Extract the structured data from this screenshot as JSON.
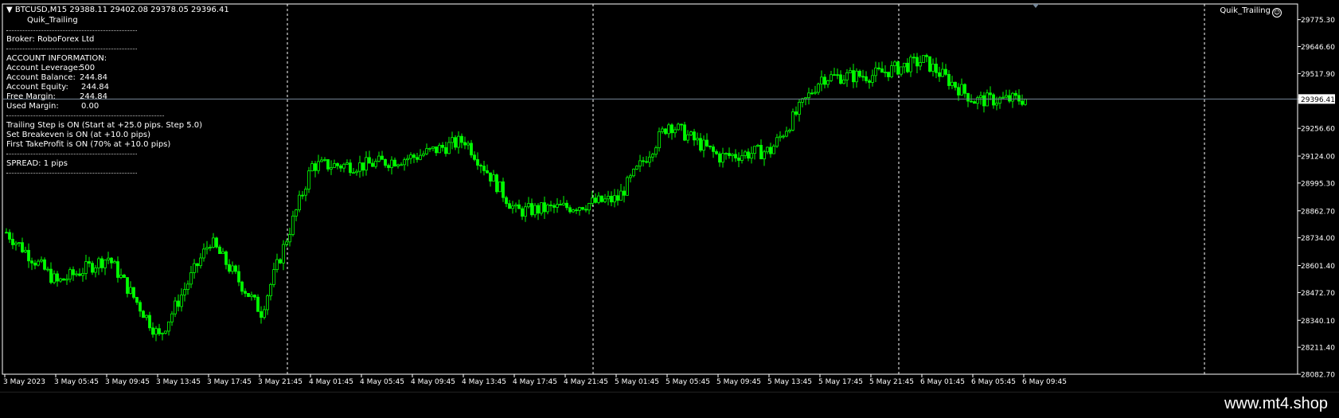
{
  "header": {
    "symbol": "BTCUSD,M15",
    "ohlc": "29388.11 29402.08 29378.05 29396.41",
    "ea_name": "Quik_Trailing",
    "ea_name_right": "Quik_Trailing"
  },
  "info_panel": {
    "broker_label": "Broker:",
    "broker_name": "RoboForex Ltd",
    "account_title": "ACCOUNT INFORMATION:",
    "rows": [
      {
        "label": "Account Leverage:",
        "value": "500"
      },
      {
        "label": "Account Balance:",
        "value": "244.84"
      },
      {
        "label": "Account Equity:",
        "value": "244.84"
      },
      {
        "label": "Free Margin:",
        "value": "244.84"
      },
      {
        "label": "Used Margin:",
        "value": "0.00"
      }
    ],
    "settings": [
      "Trailing Step is ON (Start at +25.0 pips. Step 5.0)",
      "Set Breakeven is ON (at +10.0 pips)",
      "First TakeProfit is ON (70% at +10.0 pips)"
    ],
    "spread_label": "SPREAD:",
    "spread_value": "1  pips"
  },
  "colors": {
    "background": "#000000",
    "candle_up": "#00ff00",
    "candle_down": "#00ff00",
    "bid_line": "#778899",
    "grid": "#ffffff",
    "text": "#ffffff"
  },
  "watermark": "www.mt4.shop",
  "chart_data": {
    "type": "candlestick",
    "symbol": "BTCUSD",
    "timeframe": "M15",
    "ylim": [
      28082.7,
      29850
    ],
    "y_ticks": [
      "29775.30",
      "29646.60",
      "29517.90",
      "29396.41",
      "29256.60",
      "29124.00",
      "28995.30",
      "28862.70",
      "28734.00",
      "28601.40",
      "28472.70",
      "28340.10",
      "28211.40",
      "28082.70"
    ],
    "y_tick_values": [
      29775.3,
      29646.6,
      29517.9,
      29396.41,
      29256.6,
      29124.0,
      28995.3,
      28862.7,
      28734.0,
      28601.4,
      28472.7,
      28340.1,
      28211.4,
      28082.7
    ],
    "current_price": 29396.41,
    "x_ticks": [
      "3 May 2023",
      "3 May 05:45",
      "3 May 09:45",
      "3 May 13:45",
      "3 May 17:45",
      "3 May 21:45",
      "4 May 01:45",
      "4 May 05:45",
      "4 May 09:45",
      "4 May 13:45",
      "4 May 17:45",
      "4 May 21:45",
      "5 May 01:45",
      "5 May 05:45",
      "5 May 09:45",
      "5 May 13:45",
      "5 May 17:45",
      "5 May 21:45",
      "6 May 01:45",
      "6 May 05:45",
      "6 May 09:45"
    ],
    "day_separators": [
      "3 May 23:45",
      "4 May 23:45",
      "5 May 23:45",
      "6 May 23:45"
    ],
    "close_path": [
      {
        "x": "3 May 2023",
        "y": 28760
      },
      {
        "x": "3 May 05:45",
        "y": 28520
      },
      {
        "x": "3 May 09:45",
        "y": 28640
      },
      {
        "x": "3 May 13:45",
        "y": 28260
      },
      {
        "x": "3 May 17:45",
        "y": 28720
      },
      {
        "x": "3 May 21:45",
        "y": 28380
      },
      {
        "x": "4 May 01:45",
        "y": 29080
      },
      {
        "x": "4 May 05:45",
        "y": 29080
      },
      {
        "x": "4 May 09:45",
        "y": 29120
      },
      {
        "x": "4 May 13:45",
        "y": 29200
      },
      {
        "x": "4 May 17:45",
        "y": 28860
      },
      {
        "x": "4 May 21:45",
        "y": 28880
      },
      {
        "x": "5 May 01:45",
        "y": 28920
      },
      {
        "x": "5 May 05:45",
        "y": 29280
      },
      {
        "x": "5 May 09:45",
        "y": 29120
      },
      {
        "x": "5 May 13:45",
        "y": 29150
      },
      {
        "x": "5 May 17:45",
        "y": 29500
      },
      {
        "x": "5 May 21:45",
        "y": 29510
      },
      {
        "x": "6 May 01:45",
        "y": 29580
      },
      {
        "x": "6 May 05:45",
        "y": 29390
      },
      {
        "x": "6 May 09:45",
        "y": 29396.41
      }
    ],
    "title": "",
    "xlabel": "",
    "ylabel": "",
    "grid": false
  }
}
